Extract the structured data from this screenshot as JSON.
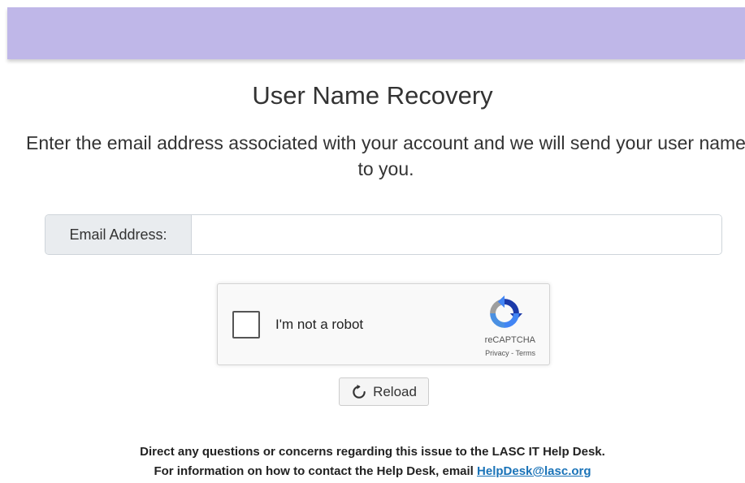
{
  "header": {
    "bar_color": "#bfb7e8"
  },
  "page": {
    "title": "User Name Recovery",
    "instructions": "Enter the email address associated with your account and we will send your user name to you."
  },
  "form": {
    "email_label": "Email Address:",
    "email_value": "",
    "email_placeholder": ""
  },
  "recaptcha": {
    "checkbox_label": "I'm not a robot",
    "brand": "reCAPTCHA",
    "privacy": "Privacy",
    "separator": " - ",
    "terms": "Terms",
    "icon": "recaptcha-logo-icon"
  },
  "reload": {
    "label": "Reload",
    "icon": "refresh-icon"
  },
  "footer": {
    "line1": "Direct any questions or concerns regarding this issue to the LASC IT Help Desk.",
    "line2_prefix": "For information on how to contact the Help Desk, email ",
    "email_link": "HelpDesk@lasc.org",
    "link_color": "#1a73b8"
  }
}
